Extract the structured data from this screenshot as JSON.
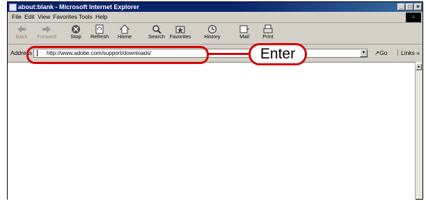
{
  "window": {
    "title": "about:blank - Microsoft Internet Explorer",
    "controls": {
      "minimize": "_",
      "maximize": "□",
      "close": "×"
    }
  },
  "menubar": {
    "items": [
      "File",
      "Edit",
      "View",
      "Favorites",
      "Tools",
      "Help"
    ]
  },
  "toolbar": {
    "buttons": [
      {
        "label": "Back",
        "icon": "back-arrow-icon",
        "enabled": false
      },
      {
        "label": "Forward",
        "icon": "forward-arrow-icon",
        "enabled": false
      },
      {
        "label": "Stop",
        "icon": "stop-icon",
        "enabled": true
      },
      {
        "label": "Refresh",
        "icon": "refresh-icon",
        "enabled": true
      },
      {
        "label": "Home",
        "icon": "home-icon",
        "enabled": true
      },
      {
        "label": "Search",
        "icon": "search-icon",
        "enabled": true
      },
      {
        "label": "Favorites",
        "icon": "favorites-icon",
        "enabled": true
      },
      {
        "label": "History",
        "icon": "history-icon",
        "enabled": true
      },
      {
        "label": "Mail",
        "icon": "mail-icon",
        "enabled": true
      },
      {
        "label": "Print",
        "icon": "print-icon",
        "enabled": true
      }
    ]
  },
  "addressbar": {
    "label": "Address",
    "value": "http://www.adobe.com/support/downloads/",
    "go_label": "Go",
    "links_label": "Links »"
  },
  "annotation": {
    "callout_text": "Enter",
    "color": "#d40000"
  }
}
